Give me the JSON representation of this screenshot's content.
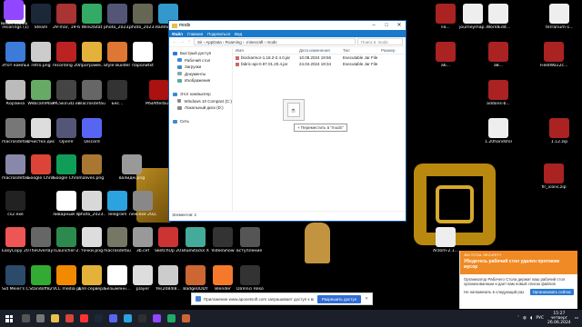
{
  "desktop_icons": [
    {
      "label": "recorings (1)",
      "color": "#f2f2f2"
    },
    {
      "label": "Steam",
      "color": "#1b2838"
    },
    {
      "label": "29-mar, 19-6...",
      "color": "#a33"
    },
    {
      "label": "WinDiStat",
      "color": "#3a6"
    },
    {
      "label": "photo_2023...",
      "color": "#557"
    },
    {
      "label": "photo_2023...",
      "color": "#665"
    },
    {
      "label": "Twitch Studio",
      "color": "#9146ff"
    },
    {
      "label": "Radmin VPN",
      "color": "#39c"
    },
    {
      "label": "Этот компьютер",
      "color": "#3c7bd8"
    },
    {
      "label": "retro.png",
      "color": "#ccc"
    },
    {
      "label": "recording 20...",
      "color": "#b22"
    },
    {
      "label": "программ...",
      "color": "#e4b23a"
    },
    {
      "label": "Style Builder 2017",
      "color": "#d73"
    },
    {
      "label": "паролиtxt",
      "color": "#fff"
    },
    {
      "label": "Корзина",
      "color": "#bbb"
    },
    {
      "label": "WebcamMax",
      "color": "#6a6"
    },
    {
      "label": "MCSkin3D.exe",
      "color": "#444"
    },
    {
      "label": "macrosdefault (1).exe",
      "color": "#666"
    },
    {
      "label": "Бес...",
      "color": "#333"
    },
    {
      "label": "MSIAfterburner",
      "color": "#a11"
    },
    {
      "label": "macrosdefault (1).exe",
      "color": "#777"
    },
    {
      "label": "Очистка диска",
      "color": "#ddd"
    },
    {
      "label": "OpenV",
      "color": "#557"
    },
    {
      "label": "Discord",
      "color": "#5865f2"
    },
    {
      "label": "macrosdefault (4).jpg",
      "color": "#88a"
    },
    {
      "label": "Google Chrome",
      "color": "#db4437"
    },
    {
      "label": "Google Chrome",
      "color": "#0f9d58"
    },
    {
      "label": "nalives.png",
      "color": "#a73"
    },
    {
      "label": "валидм.png",
      "color": "#999"
    },
    {
      "label": "cs2.exe",
      "color": "#222"
    },
    {
      "label": "ливарный лоренс",
      "color": "#fff"
    },
    {
      "label": "photo_2023...",
      "color": "#d8d8d8"
    },
    {
      "label": "Telegram",
      "color": "#2aa3df"
    },
    {
      "label": "new.exe 2022.cef",
      "color": "#888"
    },
    {
      "label": "EasyCopy 2017",
      "color": "#e55"
    },
    {
      "label": "TheOverlay",
      "color": "#666"
    },
    {
      "label": "TLauncher-2...",
      "color": "#2d8a4e"
    },
    {
      "label": "точки.png",
      "color": "#ddd"
    },
    {
      "label": "macrosdefault (1).jpg",
      "color": "#776"
    },
    {
      "label": "3b.cef",
      "color": "#999"
    },
    {
      "label": "SketchUp 2017",
      "color": "#c33"
    },
    {
      "label": "BlueStacks X",
      "color": "#4a9"
    },
    {
      "label": "VideoShow",
      "color": "#333"
    },
    {
      "label": "вступление в игру.mp4",
      "color": "#555"
    },
    {
      "label": "Sid Meier's Civilization VI",
      "color": "#2c4a6a"
    },
    {
      "label": "StandoffB2",
      "color": "#3a3"
    },
    {
      "label": "VLC media player",
      "color": "#f18a00"
    },
    {
      "label": "для сервера плавать.дом",
      "color": "#e4b23a"
    },
    {
      "label": "Безымянн...",
      "color": "#fff"
    },
    {
      "label": "player",
      "color": "#ddd"
    },
    {
      "label": "Yes2084l8...",
      "color": "#ccc"
    },
    {
      "label": "BadgeUDDY",
      "color": "#c63"
    },
    {
      "label": "Blender",
      "color": "#f5792a"
    },
    {
      "label": "DaVinci Resolve",
      "color": "#333"
    },
    {
      "label": "journeymap...",
      "color": "#eee"
    },
    {
      "label": "WorldEdit...",
      "color": "#eee"
    },
    {
      "label": "terrarium-1...",
      "color": "#eee"
    },
    {
      "label": "Fa...",
      "color": "#a22"
    },
    {
      "label": "a6...",
      "color": "#a22"
    },
    {
      "label": "a8...",
      "color": "#a22"
    },
    {
      "label": "addons-b...",
      "color": "#a22"
    },
    {
      "label": "FieldWa12c...",
      "color": "#a22"
    },
    {
      "label": "1.20handsfor...",
      "color": "#eee"
    },
    {
      "label": "1.12.zip",
      "color": "#a22"
    },
    {
      "label": "fir_icons.zip",
      "color": "#a22"
    },
    {
      "label": "Arzom-2.1...",
      "color": "#eee"
    }
  ],
  "explorer": {
    "title": "mods",
    "ribbon_tabs": [
      "Файл",
      "Главная",
      "Поделиться",
      "Вид"
    ],
    "address": "Sir › AppData › Roaming › .minecraft › mods",
    "search_placeholder": "Поиск в: mods",
    "nav_items": [
      {
        "label": "Быстрый доступ",
        "color": "#2c7ad6",
        "sub": false
      },
      {
        "label": "Рабочий стол",
        "color": "#3a8bd8",
        "sub": true
      },
      {
        "label": "Загрузки",
        "color": "#3a8bd8",
        "sub": true
      },
      {
        "label": "Документы",
        "color": "#8aa",
        "sub": true
      },
      {
        "label": "Изображения",
        "color": "#5a9",
        "sub": true
      },
      {
        "label": "",
        "color": "transparent",
        "sub": false
      },
      {
        "label": "Этот компьютер",
        "color": "#3a8bd8",
        "sub": false
      },
      {
        "label": "Windows 10 Compact (C:)",
        "color": "#888",
        "sub": true
      },
      {
        "label": "Локальный диск (D:)",
        "color": "#888",
        "sub": true
      },
      {
        "label": "",
        "color": "transparent",
        "sub": false
      },
      {
        "label": "Сеть",
        "color": "#3a8bd8",
        "sub": false
      }
    ],
    "columns": [
      "Имя",
      "Дата изменения",
      "Тип",
      "Размер"
    ],
    "files": [
      {
        "name": "blockarmor-1.18.2-2.4.0.jar",
        "date": "10.08.2024 19:56",
        "type": "Executable Jar File",
        "size": ""
      },
      {
        "name": "fabric-api-0.97.01.20.4.jar",
        "date": "24.04.2024 19:34",
        "type": "Executable Jar File",
        "size": ""
      }
    ],
    "drag_tooltip": "+ Переместить в \"mods\"",
    "status": "Элементов: 2"
  },
  "toast": {
    "app": "360 TOTAL SECURITY",
    "title": "Убедитесь рабочий стол удален протоком мусор",
    "body": "Организатор Рабочего Стола держит ваш рабочий стол организованным и дает вам новый список файлов",
    "later": "Не напоминать в следующий раз",
    "action": "Организовать сейчас"
  },
  "prompt": {
    "text": "Приложение www.aponetsoft.com запрашивает доступ к вашему веру.",
    "button": "Разрешить доступ"
  },
  "taskbar": {
    "apps": [
      {
        "name": "search",
        "color": "#555"
      },
      {
        "name": "task-view",
        "color": "#777"
      },
      {
        "name": "explorer",
        "color": "#e7c04e"
      },
      {
        "name": "chrome",
        "color": "#db4437"
      },
      {
        "name": "yandex",
        "color": "#f33"
      },
      {
        "name": "steam",
        "color": "#1b2838"
      },
      {
        "name": "discord",
        "color": "#5865f2"
      },
      {
        "name": "telegram",
        "color": "#2aa3df"
      },
      {
        "name": "obs",
        "color": "#302e31"
      },
      {
        "name": "twitch",
        "color": "#9146ff"
      },
      {
        "name": "app-11",
        "color": "#2a6"
      },
      {
        "name": "app-12",
        "color": "#c63"
      }
    ],
    "lang": "РУС",
    "time": "15:27",
    "day": "четверг",
    "date": "26.06.2024"
  }
}
